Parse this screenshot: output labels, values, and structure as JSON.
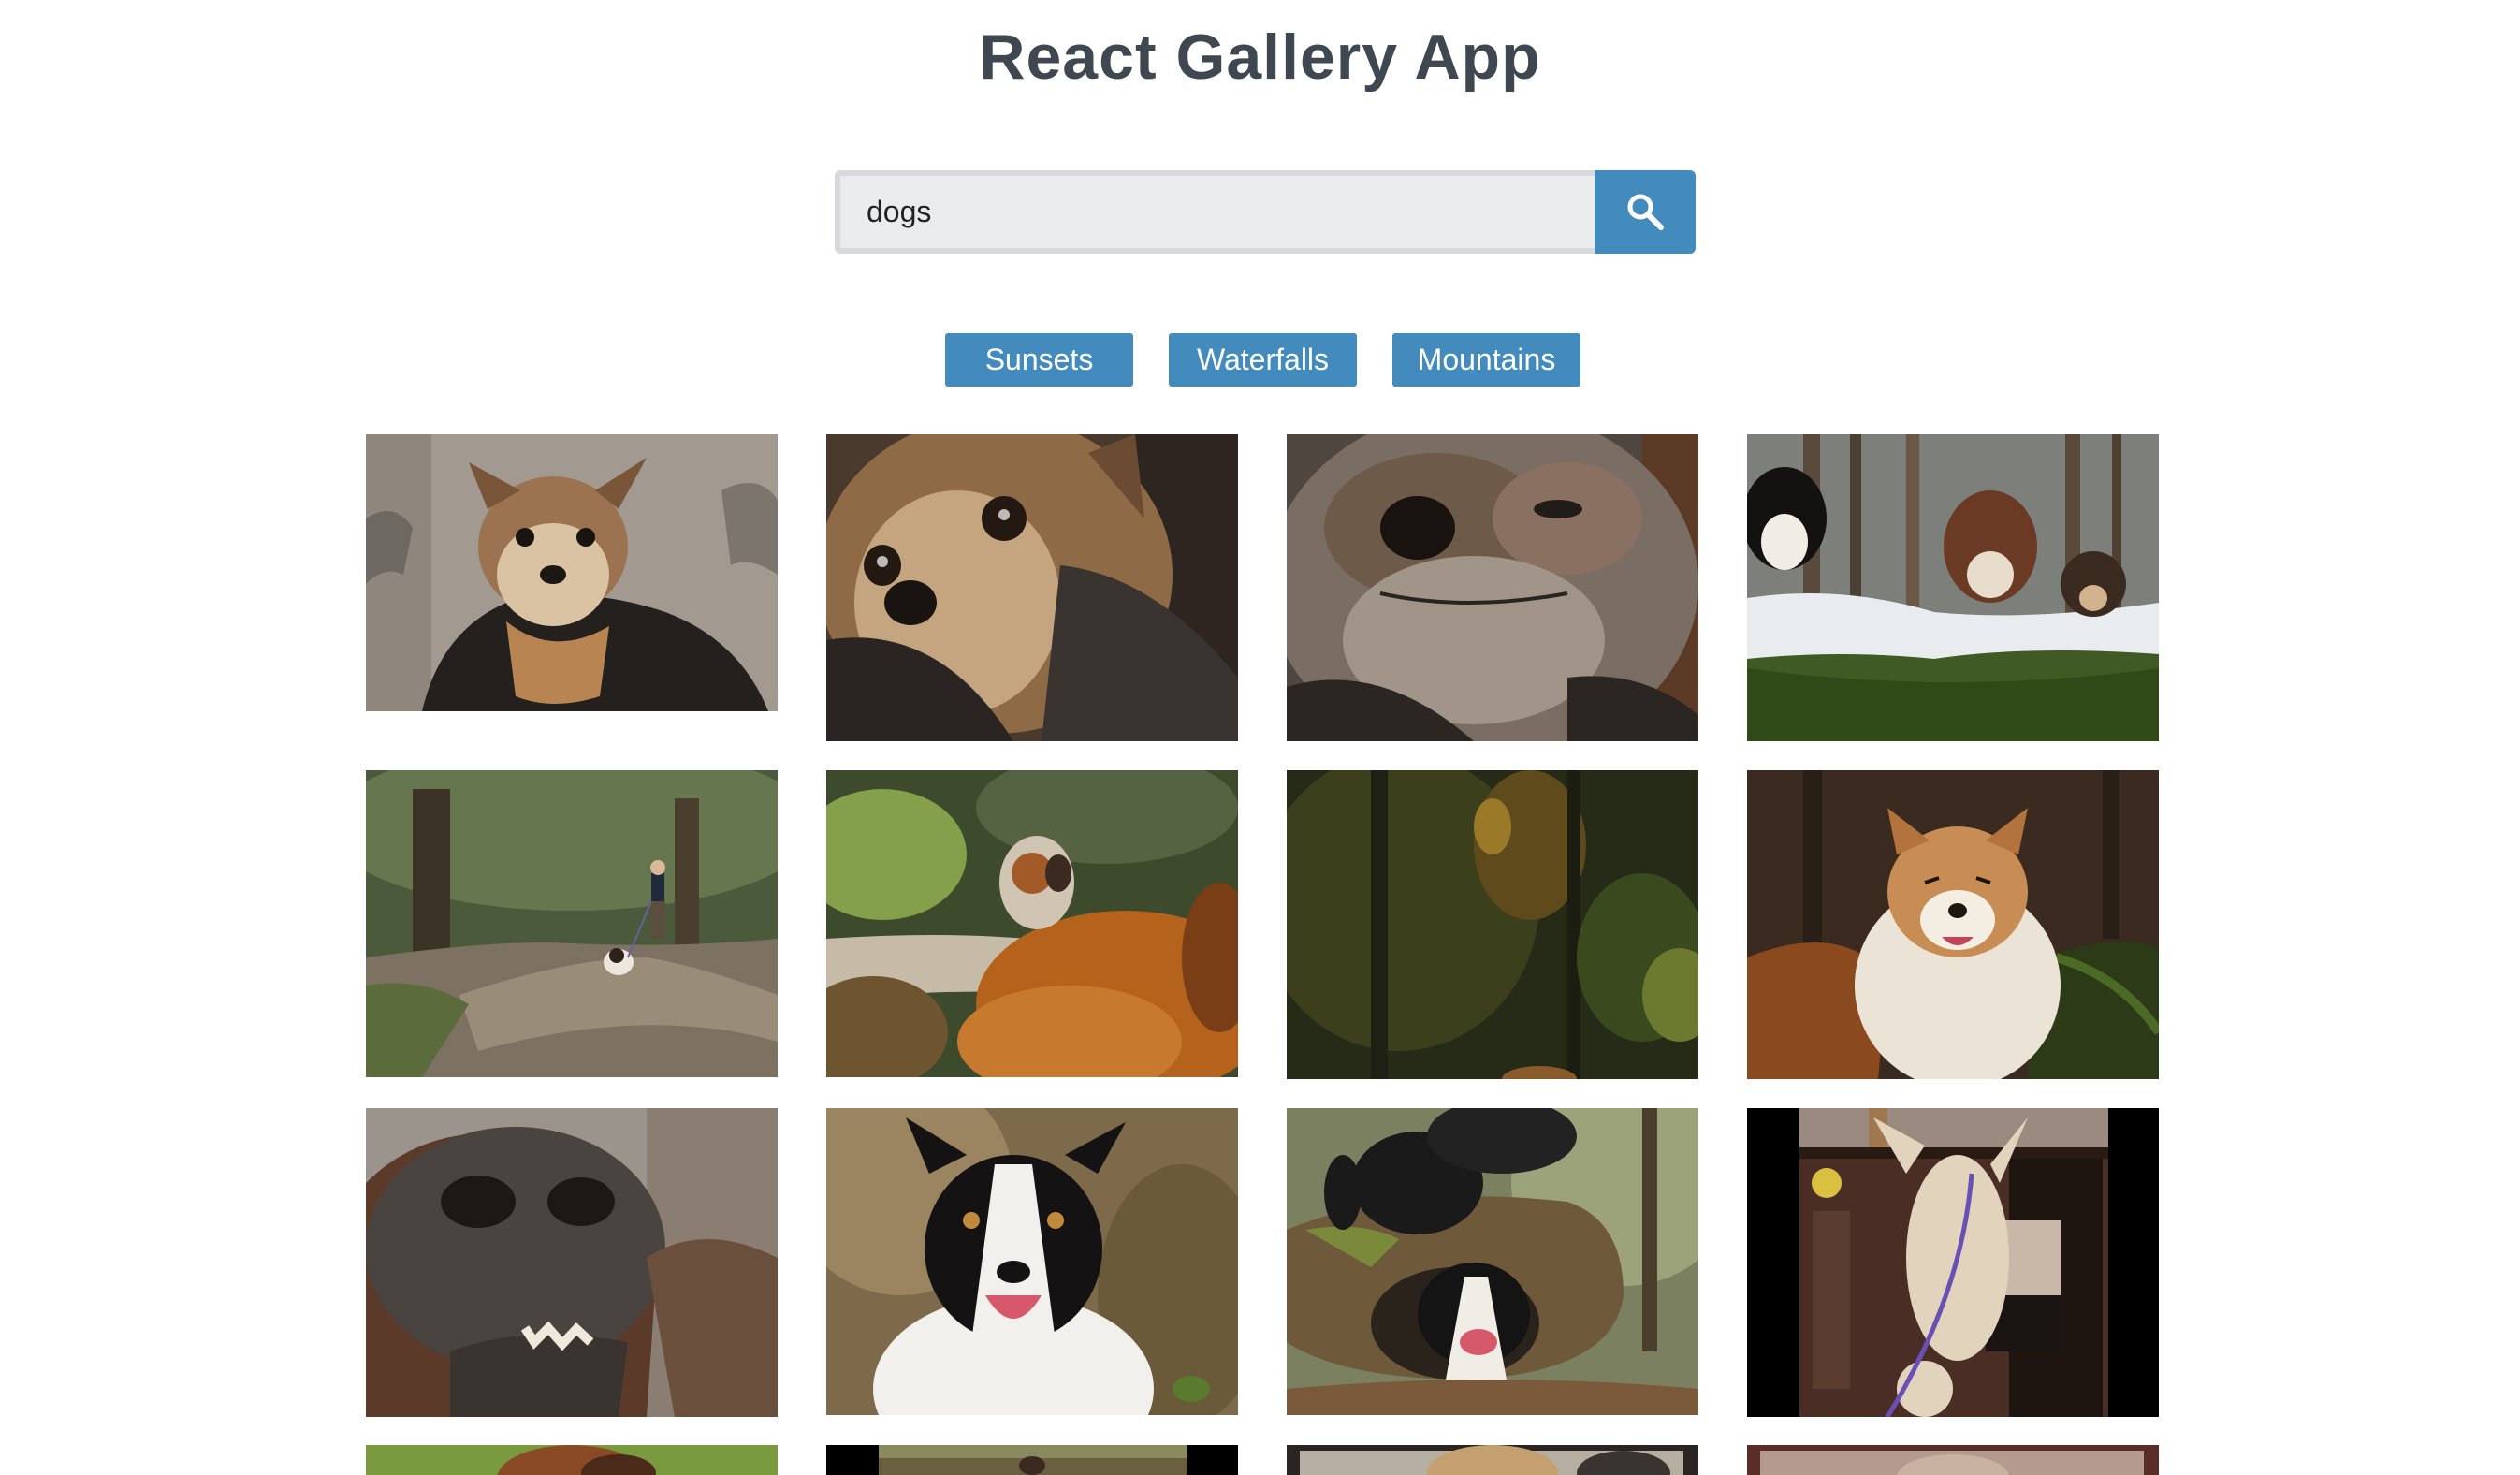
{
  "app": {
    "title": "React Gallery App"
  },
  "search": {
    "value": "dogs",
    "button_icon": "search-icon"
  },
  "nav": {
    "items": [
      {
        "label": "Sunsets"
      },
      {
        "label": "Waterfalls"
      },
      {
        "label": "Mountains"
      }
    ]
  },
  "colors": {
    "accent": "#438bbd",
    "title": "#3f4750",
    "input_bg": "#eaebed",
    "input_border": "#d7d9dc"
  },
  "gallery": {
    "photos": [
      {
        "subject": "terrier-dog"
      },
      {
        "subject": "terrier-dog-closeup"
      },
      {
        "subject": "terrier-dog-face"
      },
      {
        "subject": "three-dogs-in-snowy-forest"
      },
      {
        "subject": "woman-walking-dog"
      },
      {
        "subject": "dog-in-autumn-bushes"
      },
      {
        "subject": "blurred-forest"
      },
      {
        "subject": "fluffy-dog-in-forest"
      },
      {
        "subject": "bloodhound-nose"
      },
      {
        "subject": "border-collie"
      },
      {
        "subject": "two-dogs-on-log"
      },
      {
        "subject": "white-puppy-standing"
      },
      {
        "subject": "dog-partial"
      },
      {
        "subject": "dog-partial"
      },
      {
        "subject": "dog-partial"
      },
      {
        "subject": "dog-partial"
      }
    ]
  }
}
